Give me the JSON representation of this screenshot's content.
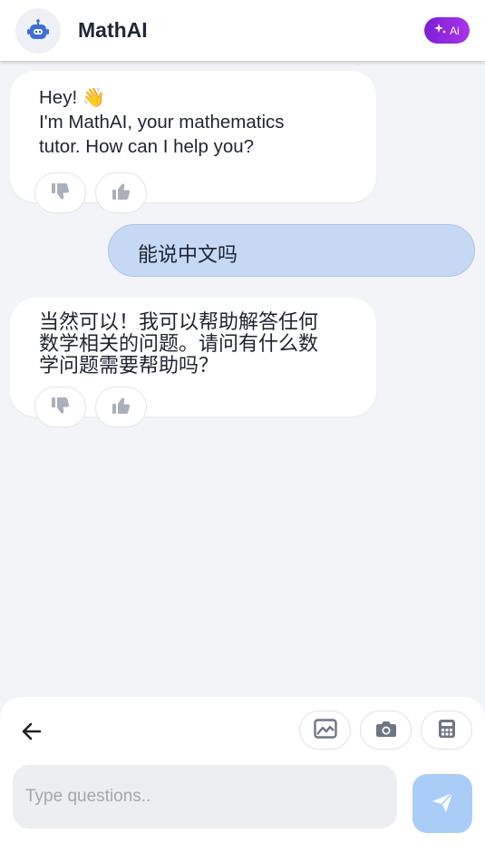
{
  "header": {
    "app_title": "MathAI",
    "ai_badge_label": "Ai",
    "logo_icon": "robot-icon",
    "badge_icon": "sparkle-icon"
  },
  "messages": [
    {
      "role": "assistant",
      "lines": [
        "Hey! 👋",
        "I'm MathAI, your mathematics",
        "tutor. How can I help you?"
      ]
    },
    {
      "role": "user",
      "text": "能说中文吗"
    },
    {
      "role": "assistant",
      "lines": [
        "当然可以！我可以帮助解答任何",
        "数学相关的问题。请问有什么数",
        "学问题需要帮助吗？"
      ]
    }
  ],
  "feedback_icons": [
    "thumbs-down-icon",
    "thumbs-up-icon"
  ],
  "composer": {
    "placeholder": "Type questions..",
    "value": "",
    "tools": [
      "image-icon",
      "camera-icon",
      "calculator-icon"
    ],
    "back_icon": "arrow-left-icon",
    "send_icon": "send-icon"
  },
  "colors": {
    "background": "#f3f4f8",
    "user_bubble": "#c5d9f5",
    "send_button": "#a9cdf7",
    "badge_gradient_start": "#7c1fd6",
    "badge_gradient_end": "#a934e8",
    "icon_gray": "#aab0bb"
  }
}
